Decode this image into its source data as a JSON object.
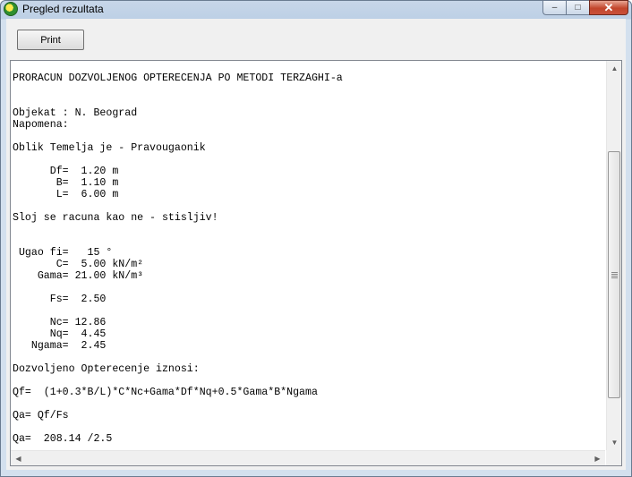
{
  "window": {
    "title": "Pregled rezultata"
  },
  "toolbar": {
    "print_label": "Print"
  },
  "caption": {
    "minimize": "–",
    "maximize": "□",
    "close": "✕"
  },
  "scroll": {
    "up": "▲",
    "down": "▼",
    "left": "◀",
    "right": "▶"
  },
  "report": {
    "lines": [
      "PRORACUN DOZVOLJENOG OPTERECENJA PO METODI TERZAGHI-a",
      "Objekat : N. Beograd",
      "Napomena:",
      "Oblik Temelja je - Pravougaonik",
      "      Df=  1.20 m",
      "       B=  1.10 m",
      "       L=  6.00 m",
      "Sloj se racuna kao ne - stisljiv!",
      " Ugao fi=   15 °",
      "       C=  5.00 kN/m²",
      "    Gama= 21.00 kN/m³",
      "      Fs=  2.50",
      "      Nc= 12.86",
      "      Nq=  4.45",
      "   Ngama=  2.45",
      "Dozvoljeno Opterecenje iznosi:",
      "Qf=  (1+0.3*B/L)*C*Nc+Gama*Df*Nq+0.5*Gama*B*Ngama",
      "Qa= Qf/Fs",
      "Qa=  208.14 /2.5"
    ]
  }
}
